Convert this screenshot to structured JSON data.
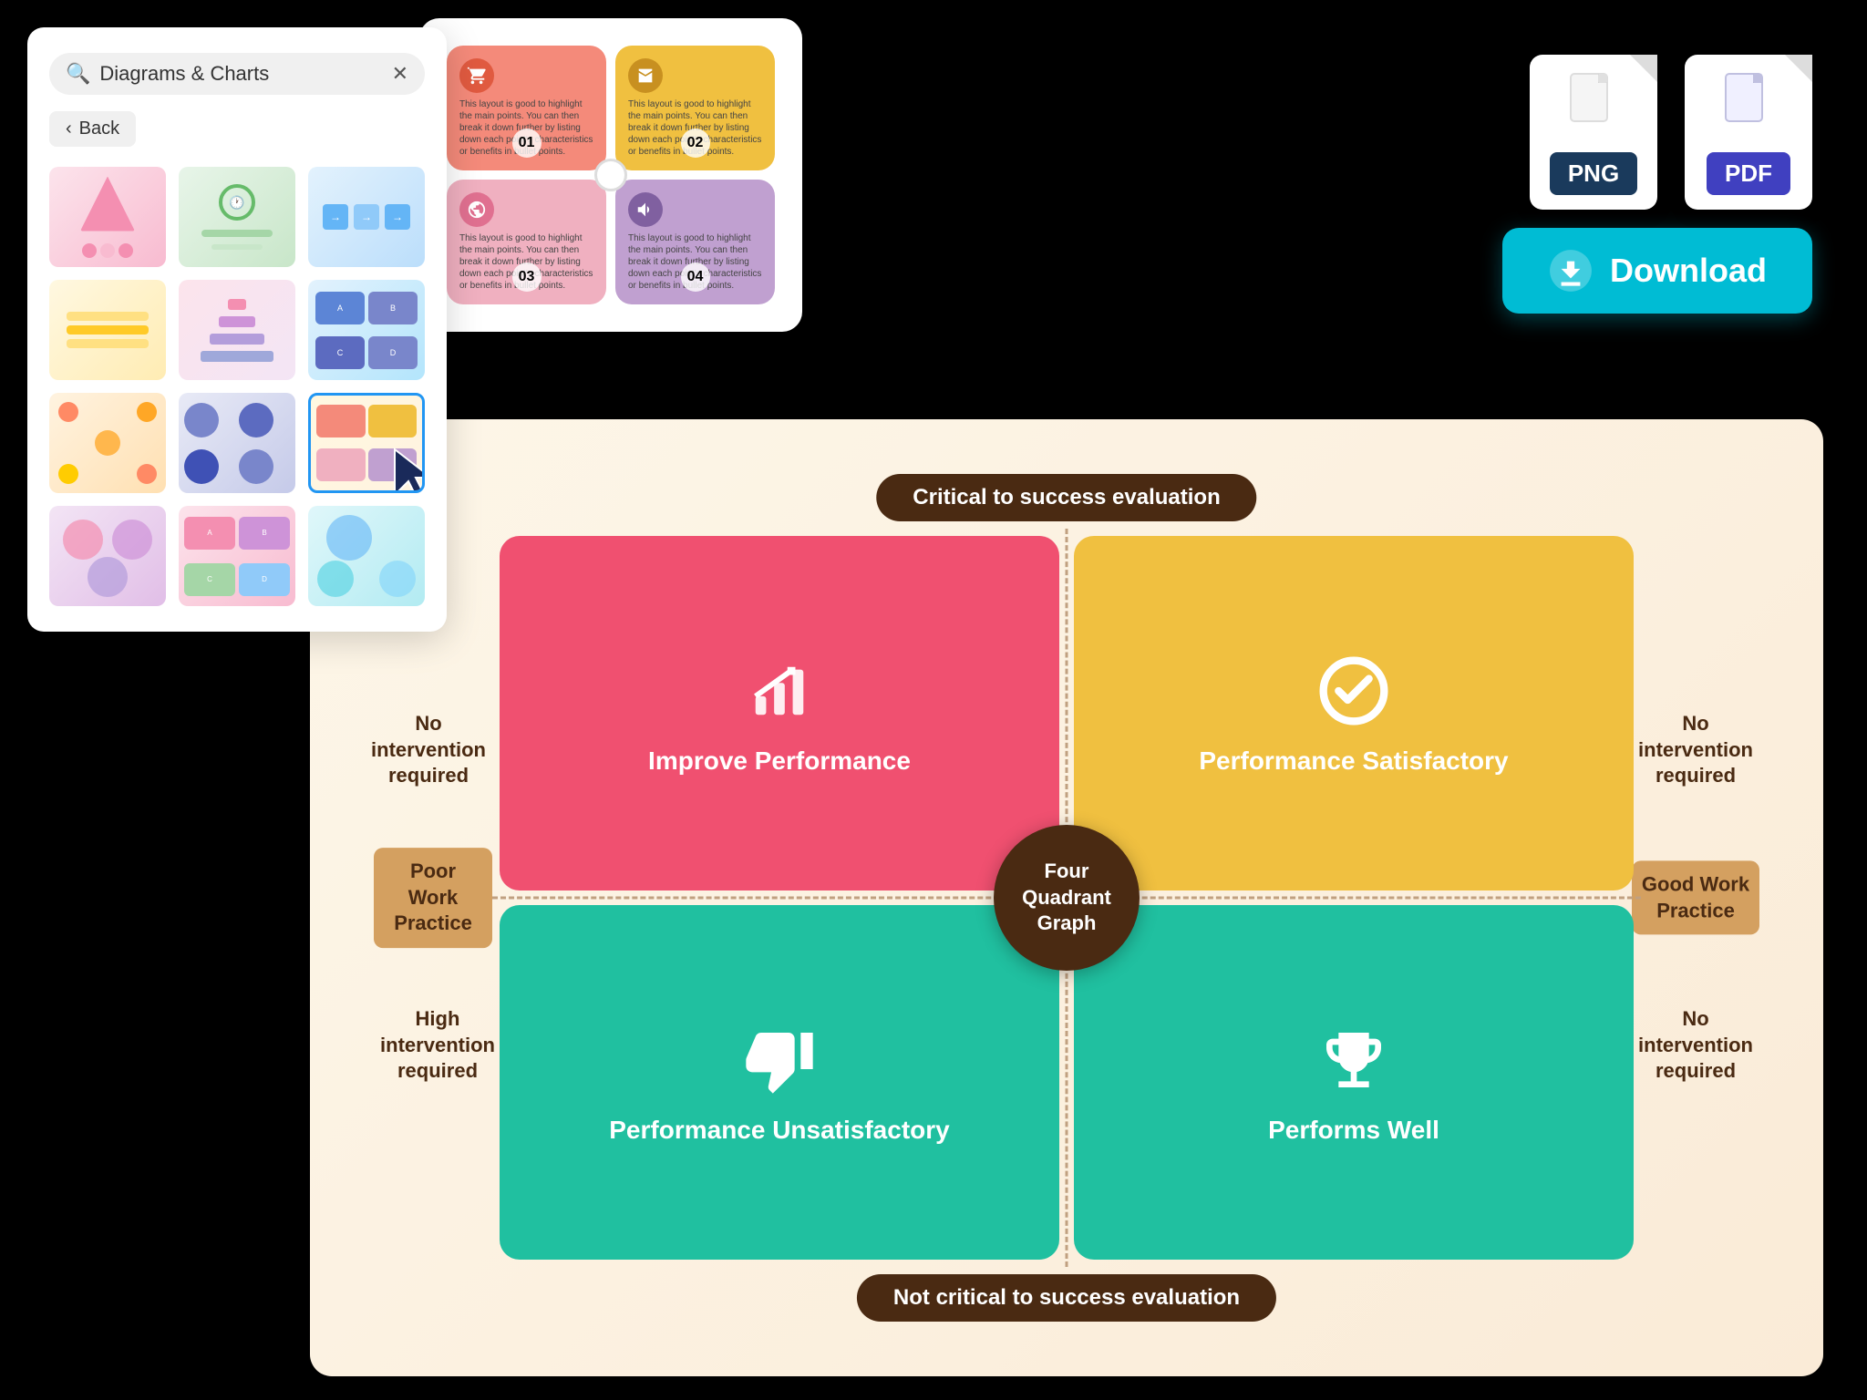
{
  "app": {
    "title": "Diagrams & Charts"
  },
  "left_panel": {
    "search_placeholder": "Diagrams & Charts",
    "search_value": "Diagrams & Charts",
    "back_label": "Back",
    "thumbnails": [
      {
        "id": "thumb-1",
        "style": "thumb-pink-tri"
      },
      {
        "id": "thumb-2",
        "style": "thumb-clock"
      },
      {
        "id": "thumb-3",
        "style": "thumb-arrows"
      },
      {
        "id": "thumb-4",
        "style": "thumb-syringes"
      },
      {
        "id": "thumb-5",
        "style": "thumb-pyramid"
      },
      {
        "id": "thumb-6",
        "style": "thumb-blue-sq"
      },
      {
        "id": "thumb-7",
        "style": "thumb-circles-org"
      },
      {
        "id": "thumb-8",
        "style": "thumb-blue-circles"
      },
      {
        "id": "thumb-9",
        "style": "thumb-selected-quad",
        "selected": true
      },
      {
        "id": "thumb-10",
        "style": "thumb-venn-color"
      },
      {
        "id": "thumb-11",
        "style": "thumb-pastel-quad"
      },
      {
        "id": "thumb-12",
        "style": "thumb-venn-blue"
      }
    ]
  },
  "center_card": {
    "quads": [
      {
        "id": "q1",
        "number": "01",
        "text": "This layout is good to highlight the main points. You can then break it down further by listing down each point's characteristics or benefits in bullet points."
      },
      {
        "id": "q2",
        "number": "02",
        "text": "This layout is good to highlight the main points. You can then break it down further by listing down each point's characteristics or benefits in bullet points."
      },
      {
        "id": "q3",
        "number": "03",
        "text": "This layout is good to highlight the main points. You can then break it down further by listing down each point's characteristics or benefits in bullet points."
      },
      {
        "id": "q4",
        "number": "04",
        "text": "This layout is good to highlight the main points. You can then break it down further by listing down each point's characteristics or benefits in bullet points."
      }
    ]
  },
  "file_options": {
    "png_label": "PNG",
    "pdf_label": "PDF"
  },
  "download": {
    "label": "Download"
  },
  "bottom_diagram": {
    "title_top": "Critical to success evaluation",
    "title_bottom": "Not critical to success evaluation",
    "label_left_top": "No intervention required",
    "label_left_bottom": "High intervention required",
    "label_right_top": "No intervention required",
    "label_right_bottom": "No intervention required",
    "label_poor": "Poor Work Practice",
    "center_line1": "Four",
    "center_line2": "Quadrant",
    "center_line3": "Graph",
    "quadrants": [
      {
        "id": "tl",
        "title": "Improve Performance",
        "color": "#f05070"
      },
      {
        "id": "tr",
        "title": "Performance Satisfactory",
        "color": "#f0c040"
      },
      {
        "id": "bl",
        "title": "Performance Unsatisfactory",
        "color": "#20c0a0"
      },
      {
        "id": "br",
        "title": "Performs Well",
        "color": "#20c0a0"
      }
    ],
    "label_good_work": "Good Work Practice"
  }
}
